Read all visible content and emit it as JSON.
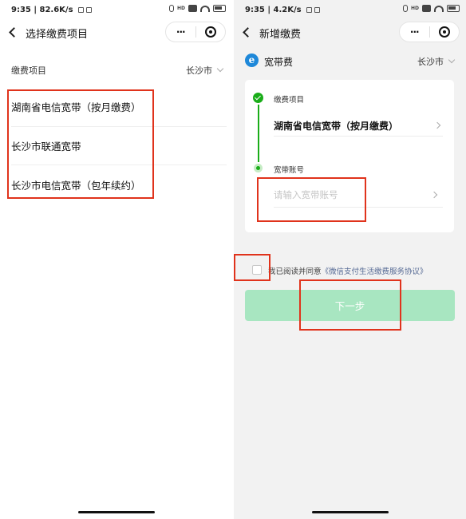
{
  "left_screen": {
    "status": {
      "time_speed": "9:35 | 82.6K/s",
      "hd": "HD",
      "battery": "45"
    },
    "nav": {
      "title": "选择缴费项目",
      "more": "···"
    },
    "header": {
      "label": "缴费项目",
      "city": "长沙市"
    },
    "plans": [
      {
        "label": "湖南省电信宽带（按月缴费）"
      },
      {
        "label": "长沙市联通宽带"
      },
      {
        "label": "长沙市电信宽带（包年续约）"
      }
    ]
  },
  "right_screen": {
    "status": {
      "time_speed": "9:35 | 4.2K/s",
      "hd": "HD",
      "battery": "45"
    },
    "nav": {
      "title": "新增缴费",
      "more": "···"
    },
    "header": {
      "logo_letter": "e",
      "label": "宽带费",
      "city": "长沙市"
    },
    "form": {
      "item_label": "缴费项目",
      "item_value": "湖南省电信宽带（按月缴费）",
      "account_label": "宽带账号",
      "account_placeholder": "请输入宽带账号",
      "account_value": ""
    },
    "agreement": {
      "prefix": "我已阅读并同意",
      "link": "《微信支付生活缴费服务协议》"
    },
    "next_button": "下一步"
  },
  "colors": {
    "annotation_red": "#e0331c",
    "success_green": "#1aad19",
    "disabled_button": "#a8e6c1",
    "link_blue": "#576b95",
    "logo_blue": "#1e88d9"
  }
}
